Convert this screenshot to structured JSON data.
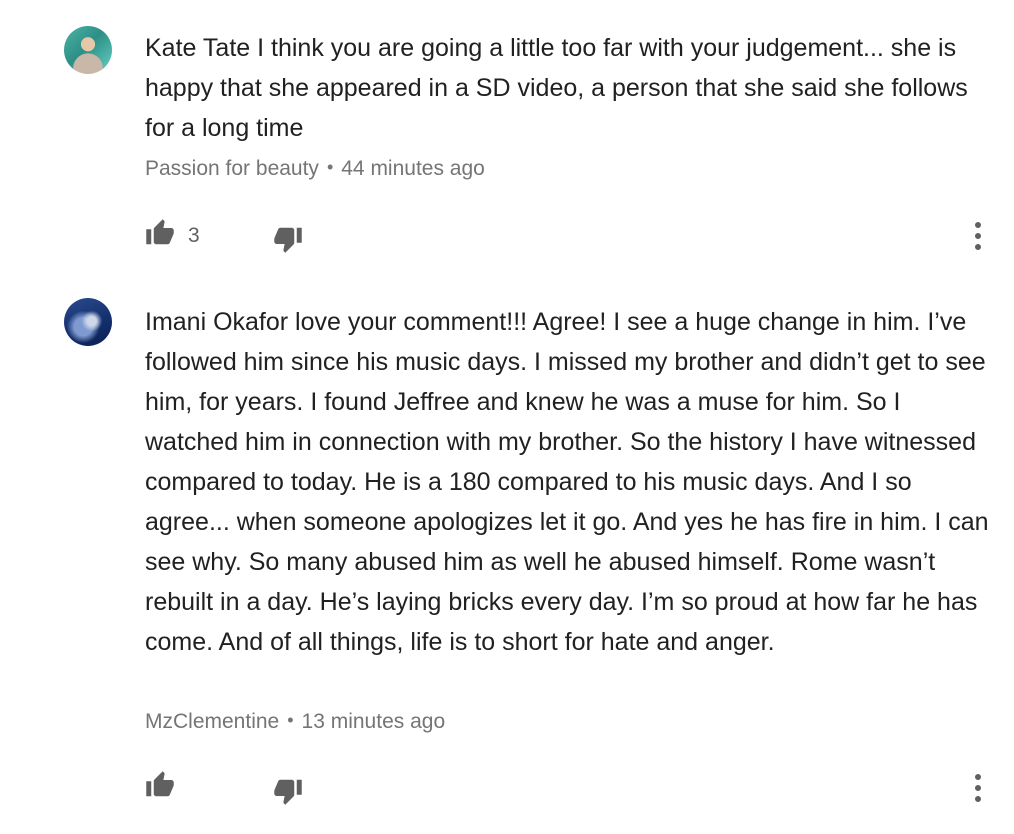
{
  "comments": [
    {
      "text": "Kate Tate I think you are going a little too far with your judgement... she is happy that she appeared in a SD video, a person that she said she follows for a long time",
      "author": "Passion for beauty",
      "separator": "•",
      "time": "44 minutes ago",
      "likes": "3",
      "avatar": "avatar-teal-hair"
    },
    {
      "text": "Imani Okafor love your comment!!! Agree! I see a huge change in him. I’ve followed him since his music days. I missed my brother and didn’t get to see him, for years. I found Jeffree and knew he was a muse for him. So I watched him in connection with my brother. So the history I have witnessed compared to today. He is a 180 compared to his music days. And I so agree... when someone apologizes let it go. And yes he has fire in him. I can see why. So many abused him as well he abused himself. Rome wasn’t rebuilt in a day. He’s laying bricks every day. I’m so proud at how far he has come. And of all things, life is to short for hate and anger.",
      "author": "MzClementine",
      "separator": "•",
      "time": "13 minutes ago",
      "likes": "",
      "avatar": "avatar-blue-earth"
    }
  ],
  "icons": {
    "like": "thumb-up-icon",
    "dislike": "thumb-down-icon",
    "more": "more-vert-icon"
  },
  "colors": {
    "text": "#212121",
    "meta": "#757575",
    "icon": "#606060"
  }
}
